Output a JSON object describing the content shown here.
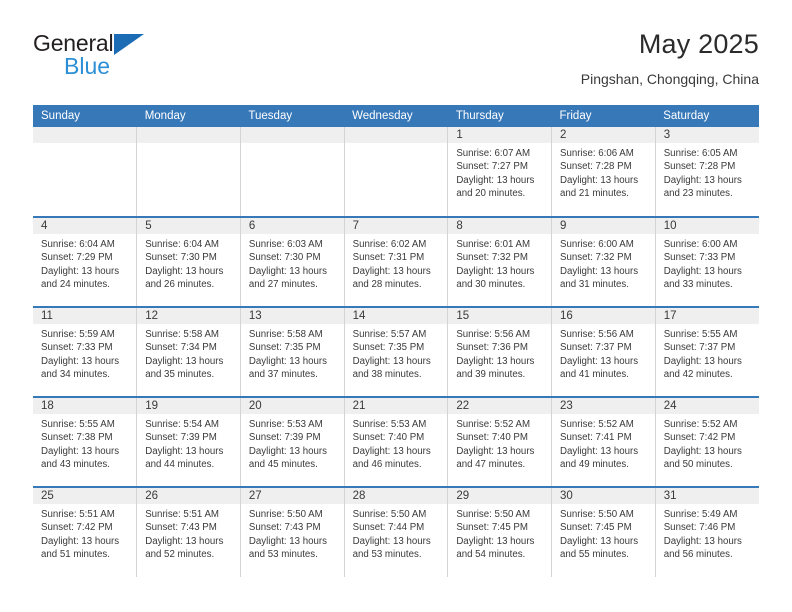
{
  "brand": {
    "name_top": "General",
    "name_bottom": "Blue",
    "triangle_icon": "blue-triangle-logo-mark",
    "accent_color": "#2c8fd6",
    "header_blue": "#3778b9"
  },
  "header": {
    "title": "May 2025",
    "subtitle": "Pingshan, Chongqing, China"
  },
  "calendar": {
    "weekday_headers": [
      "Sunday",
      "Monday",
      "Tuesday",
      "Wednesday",
      "Thursday",
      "Friday",
      "Saturday"
    ],
    "labels": {
      "sunrise": "Sunrise:",
      "sunset": "Sunset:",
      "daylight": "Daylight:"
    },
    "weeks": [
      [
        {
          "day": "",
          "empty": true,
          "sunrise": "",
          "sunset": "",
          "daylight_line1": "",
          "daylight_line2": ""
        },
        {
          "day": "",
          "empty": true,
          "sunrise": "",
          "sunset": "",
          "daylight_line1": "",
          "daylight_line2": ""
        },
        {
          "day": "",
          "empty": true,
          "sunrise": "",
          "sunset": "",
          "daylight_line1": "",
          "daylight_line2": ""
        },
        {
          "day": "",
          "empty": true,
          "sunrise": "",
          "sunset": "",
          "daylight_line1": "",
          "daylight_line2": ""
        },
        {
          "day": "1",
          "empty": false,
          "sunrise": "Sunrise: 6:07 AM",
          "sunset": "Sunset: 7:27 PM",
          "daylight_line1": "Daylight: 13 hours",
          "daylight_line2": "and 20 minutes."
        },
        {
          "day": "2",
          "empty": false,
          "sunrise": "Sunrise: 6:06 AM",
          "sunset": "Sunset: 7:28 PM",
          "daylight_line1": "Daylight: 13 hours",
          "daylight_line2": "and 21 minutes."
        },
        {
          "day": "3",
          "empty": false,
          "sunrise": "Sunrise: 6:05 AM",
          "sunset": "Sunset: 7:28 PM",
          "daylight_line1": "Daylight: 13 hours",
          "daylight_line2": "and 23 minutes."
        }
      ],
      [
        {
          "day": "4",
          "empty": false,
          "sunrise": "Sunrise: 6:04 AM",
          "sunset": "Sunset: 7:29 PM",
          "daylight_line1": "Daylight: 13 hours",
          "daylight_line2": "and 24 minutes."
        },
        {
          "day": "5",
          "empty": false,
          "sunrise": "Sunrise: 6:04 AM",
          "sunset": "Sunset: 7:30 PM",
          "daylight_line1": "Daylight: 13 hours",
          "daylight_line2": "and 26 minutes."
        },
        {
          "day": "6",
          "empty": false,
          "sunrise": "Sunrise: 6:03 AM",
          "sunset": "Sunset: 7:30 PM",
          "daylight_line1": "Daylight: 13 hours",
          "daylight_line2": "and 27 minutes."
        },
        {
          "day": "7",
          "empty": false,
          "sunrise": "Sunrise: 6:02 AM",
          "sunset": "Sunset: 7:31 PM",
          "daylight_line1": "Daylight: 13 hours",
          "daylight_line2": "and 28 minutes."
        },
        {
          "day": "8",
          "empty": false,
          "sunrise": "Sunrise: 6:01 AM",
          "sunset": "Sunset: 7:32 PM",
          "daylight_line1": "Daylight: 13 hours",
          "daylight_line2": "and 30 minutes."
        },
        {
          "day": "9",
          "empty": false,
          "sunrise": "Sunrise: 6:00 AM",
          "sunset": "Sunset: 7:32 PM",
          "daylight_line1": "Daylight: 13 hours",
          "daylight_line2": "and 31 minutes."
        },
        {
          "day": "10",
          "empty": false,
          "sunrise": "Sunrise: 6:00 AM",
          "sunset": "Sunset: 7:33 PM",
          "daylight_line1": "Daylight: 13 hours",
          "daylight_line2": "and 33 minutes."
        }
      ],
      [
        {
          "day": "11",
          "empty": false,
          "sunrise": "Sunrise: 5:59 AM",
          "sunset": "Sunset: 7:33 PM",
          "daylight_line1": "Daylight: 13 hours",
          "daylight_line2": "and 34 minutes."
        },
        {
          "day": "12",
          "empty": false,
          "sunrise": "Sunrise: 5:58 AM",
          "sunset": "Sunset: 7:34 PM",
          "daylight_line1": "Daylight: 13 hours",
          "daylight_line2": "and 35 minutes."
        },
        {
          "day": "13",
          "empty": false,
          "sunrise": "Sunrise: 5:58 AM",
          "sunset": "Sunset: 7:35 PM",
          "daylight_line1": "Daylight: 13 hours",
          "daylight_line2": "and 37 minutes."
        },
        {
          "day": "14",
          "empty": false,
          "sunrise": "Sunrise: 5:57 AM",
          "sunset": "Sunset: 7:35 PM",
          "daylight_line1": "Daylight: 13 hours",
          "daylight_line2": "and 38 minutes."
        },
        {
          "day": "15",
          "empty": false,
          "sunrise": "Sunrise: 5:56 AM",
          "sunset": "Sunset: 7:36 PM",
          "daylight_line1": "Daylight: 13 hours",
          "daylight_line2": "and 39 minutes."
        },
        {
          "day": "16",
          "empty": false,
          "sunrise": "Sunrise: 5:56 AM",
          "sunset": "Sunset: 7:37 PM",
          "daylight_line1": "Daylight: 13 hours",
          "daylight_line2": "and 41 minutes."
        },
        {
          "day": "17",
          "empty": false,
          "sunrise": "Sunrise: 5:55 AM",
          "sunset": "Sunset: 7:37 PM",
          "daylight_line1": "Daylight: 13 hours",
          "daylight_line2": "and 42 minutes."
        }
      ],
      [
        {
          "day": "18",
          "empty": false,
          "sunrise": "Sunrise: 5:55 AM",
          "sunset": "Sunset: 7:38 PM",
          "daylight_line1": "Daylight: 13 hours",
          "daylight_line2": "and 43 minutes."
        },
        {
          "day": "19",
          "empty": false,
          "sunrise": "Sunrise: 5:54 AM",
          "sunset": "Sunset: 7:39 PM",
          "daylight_line1": "Daylight: 13 hours",
          "daylight_line2": "and 44 minutes."
        },
        {
          "day": "20",
          "empty": false,
          "sunrise": "Sunrise: 5:53 AM",
          "sunset": "Sunset: 7:39 PM",
          "daylight_line1": "Daylight: 13 hours",
          "daylight_line2": "and 45 minutes."
        },
        {
          "day": "21",
          "empty": false,
          "sunrise": "Sunrise: 5:53 AM",
          "sunset": "Sunset: 7:40 PM",
          "daylight_line1": "Daylight: 13 hours",
          "daylight_line2": "and 46 minutes."
        },
        {
          "day": "22",
          "empty": false,
          "sunrise": "Sunrise: 5:52 AM",
          "sunset": "Sunset: 7:40 PM",
          "daylight_line1": "Daylight: 13 hours",
          "daylight_line2": "and 47 minutes."
        },
        {
          "day": "23",
          "empty": false,
          "sunrise": "Sunrise: 5:52 AM",
          "sunset": "Sunset: 7:41 PM",
          "daylight_line1": "Daylight: 13 hours",
          "daylight_line2": "and 49 minutes."
        },
        {
          "day": "24",
          "empty": false,
          "sunrise": "Sunrise: 5:52 AM",
          "sunset": "Sunset: 7:42 PM",
          "daylight_line1": "Daylight: 13 hours",
          "daylight_line2": "and 50 minutes."
        }
      ],
      [
        {
          "day": "25",
          "empty": false,
          "sunrise": "Sunrise: 5:51 AM",
          "sunset": "Sunset: 7:42 PM",
          "daylight_line1": "Daylight: 13 hours",
          "daylight_line2": "and 51 minutes."
        },
        {
          "day": "26",
          "empty": false,
          "sunrise": "Sunrise: 5:51 AM",
          "sunset": "Sunset: 7:43 PM",
          "daylight_line1": "Daylight: 13 hours",
          "daylight_line2": "and 52 minutes."
        },
        {
          "day": "27",
          "empty": false,
          "sunrise": "Sunrise: 5:50 AM",
          "sunset": "Sunset: 7:43 PM",
          "daylight_line1": "Daylight: 13 hours",
          "daylight_line2": "and 53 minutes."
        },
        {
          "day": "28",
          "empty": false,
          "sunrise": "Sunrise: 5:50 AM",
          "sunset": "Sunset: 7:44 PM",
          "daylight_line1": "Daylight: 13 hours",
          "daylight_line2": "and 53 minutes."
        },
        {
          "day": "29",
          "empty": false,
          "sunrise": "Sunrise: 5:50 AM",
          "sunset": "Sunset: 7:45 PM",
          "daylight_line1": "Daylight: 13 hours",
          "daylight_line2": "and 54 minutes."
        },
        {
          "day": "30",
          "empty": false,
          "sunrise": "Sunrise: 5:50 AM",
          "sunset": "Sunset: 7:45 PM",
          "daylight_line1": "Daylight: 13 hours",
          "daylight_line2": "and 55 minutes."
        },
        {
          "day": "31",
          "empty": false,
          "sunrise": "Sunrise: 5:49 AM",
          "sunset": "Sunset: 7:46 PM",
          "daylight_line1": "Daylight: 13 hours",
          "daylight_line2": "and 56 minutes."
        }
      ]
    ]
  }
}
